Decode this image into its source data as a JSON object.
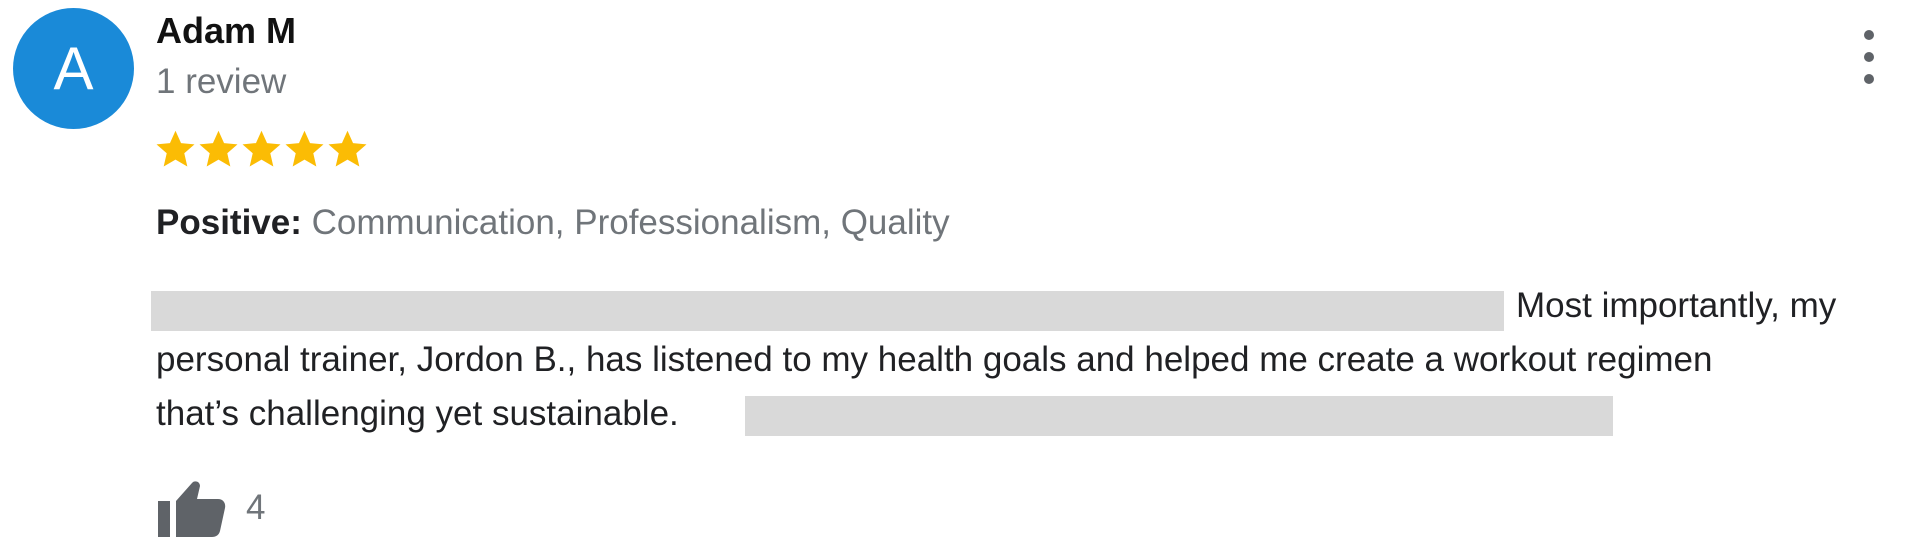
{
  "review": {
    "author": {
      "initial": "A",
      "name": "Adam M",
      "review_count": "1 review",
      "avatar_color": "#1a8ad8"
    },
    "rating": {
      "stars": 5,
      "max_stars": 5,
      "star_color": "#fbbc04"
    },
    "attributes": {
      "label": "Positive:",
      "values": "Communication, Professionalism, Quality"
    },
    "text": {
      "line1_end": "Most importantly, my",
      "line2": "personal trainer, Jordon B., has listened to my health goals and helped me create a workout regimen",
      "line3_start": "that’s challenging yet sustainable."
    },
    "likes": {
      "count": "4",
      "icon": "thumbs-up-icon"
    },
    "menu": {
      "icon": "more-vert-icon"
    }
  }
}
